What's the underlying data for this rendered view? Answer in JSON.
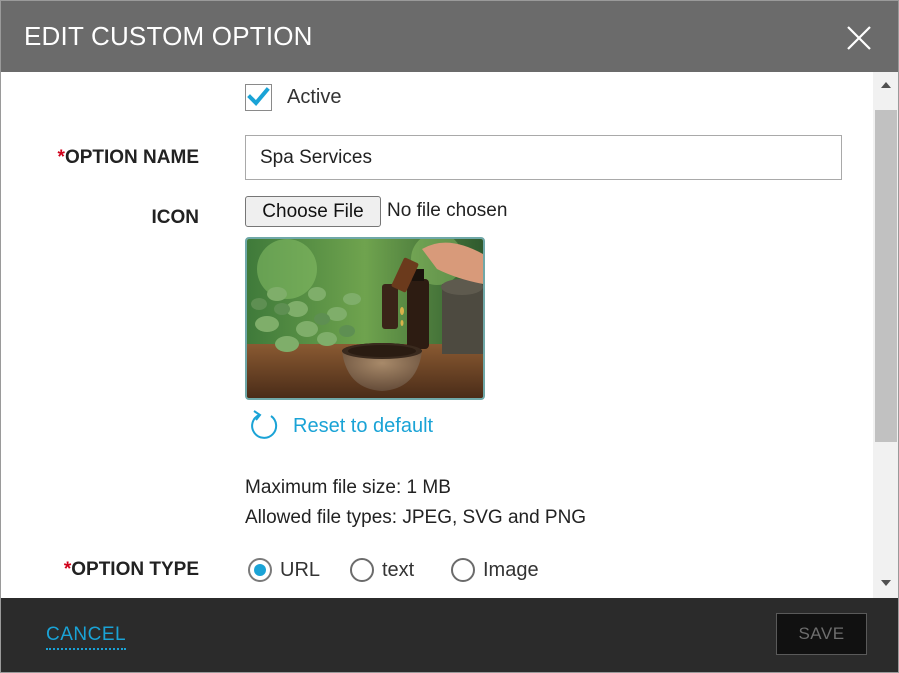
{
  "dialog": {
    "title": "EDIT CUSTOM OPTION"
  },
  "form": {
    "active": {
      "label": "Active",
      "checked": true
    },
    "option_name": {
      "required_mark": "*",
      "label": "OPTION NAME",
      "value": "Spa Services"
    },
    "icon": {
      "label": "ICON",
      "choose_file_label": "Choose File",
      "file_status": "No file chosen",
      "reset_label": "Reset to default",
      "max_size_text": "Maximum file size: 1 MB",
      "allowed_types_text": "Allowed file types: JPEG, SVG and PNG"
    },
    "option_type": {
      "required_mark": "*",
      "label": "OPTION TYPE",
      "options": [
        {
          "label": "URL",
          "selected": true
        },
        {
          "label": "text",
          "selected": false
        },
        {
          "label": "Image",
          "selected": false
        }
      ]
    }
  },
  "footer": {
    "cancel_label": "CANCEL",
    "save_label": "SAVE"
  },
  "colors": {
    "header_bg": "#6b6b6b",
    "accent": "#1aa3d6",
    "required": "#d0021b",
    "footer_bg": "#2b2b2b"
  },
  "icons": {
    "close": "close-icon",
    "checkmark": "checkmark-icon",
    "reset": "refresh-icon",
    "scroll_up": "scroll-up-arrow-icon",
    "scroll_down": "scroll-down-arrow-icon"
  }
}
